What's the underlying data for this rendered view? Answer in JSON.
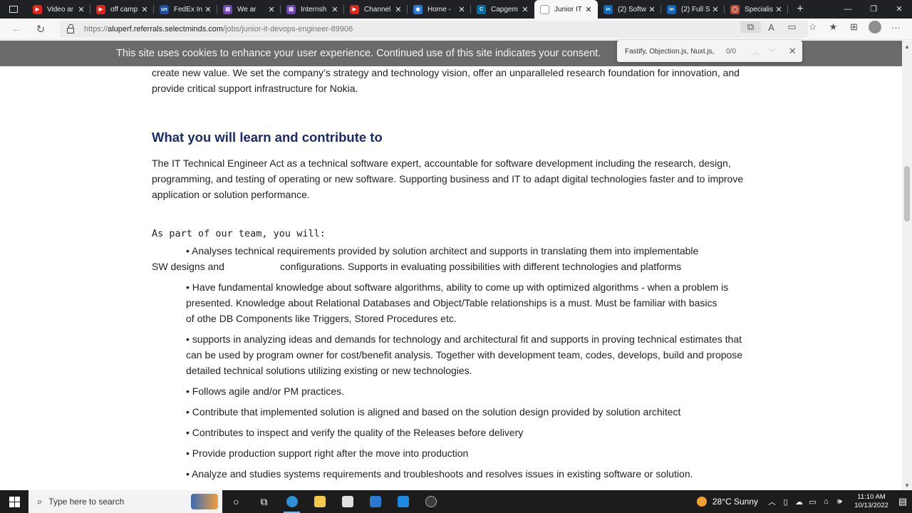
{
  "browser": {
    "tabs": [
      {
        "label": "Video ar",
        "favicon": "youtube-icon",
        "color": "#e62117",
        "glyph": "▶"
      },
      {
        "label": "off camp",
        "favicon": "youtube-icon",
        "color": "#e62117",
        "glyph": "▶"
      },
      {
        "label": "FedEx In",
        "favicon": "unstop-icon",
        "color": "#1c4fa0",
        "glyph": "un"
      },
      {
        "label": "We ar",
        "favicon": "forms-icon",
        "color": "#7248b9",
        "glyph": "▤"
      },
      {
        "label": "Internsh",
        "favicon": "forms-icon",
        "color": "#7248b9",
        "glyph": "▤"
      },
      {
        "label": "Channel",
        "favicon": "youtube-icon",
        "color": "#e62117",
        "glyph": "▶"
      },
      {
        "label": "Home -",
        "favicon": "edge-globe-icon",
        "color": "#2b79d7",
        "glyph": "◉"
      },
      {
        "label": "Capgem",
        "favicon": "capgemini-icon",
        "color": "#0070ad",
        "glyph": "C"
      },
      {
        "label": "Junior IT",
        "favicon": "blank-page-icon",
        "color": "#ffffff",
        "glyph": ""
      },
      {
        "label": "(2) Softw",
        "favicon": "linkedin-icon",
        "color": "#0a66c2",
        "glyph": "in"
      },
      {
        "label": "(2) Full S",
        "favicon": "linkedin-icon",
        "color": "#0a66c2",
        "glyph": "in"
      },
      {
        "label": "Specialis",
        "favicon": "oracle-icon",
        "color": "#c74634",
        "glyph": "◯"
      }
    ],
    "active_tab_index": 8,
    "url_prefix": "https://",
    "url_domain": "aluperf.referrals.selectminds.com",
    "url_path": "/jobs/junior-it-devops-engineer-89906"
  },
  "cookie_banner": {
    "text": "This site uses cookies to enhance your user experience. Continued use of this site indicates your consent."
  },
  "find_bar": {
    "query": "Fastify, Objection.js, Nuxt.js,",
    "count": "0/0"
  },
  "page": {
    "intro_line1": "create new value. We set the company’s strategy and technology vision, offer an unparalleled research foundation for innovation, and",
    "intro_line2": "provide critical support infrastructure for Nokia.",
    "heading": "What you will learn and contribute to",
    "desc_line1": "The IT Technical Engineer Act as a technical software expert, accountable for software development including the research, design,",
    "desc_line2": "programming, and testing of operating or new software. Supporting business and IT to adapt digital technologies faster and to improve",
    "desc_line3": "application or solution performance.",
    "team_label": "As part of our team, you will:",
    "b1_line1": "• Analyses technical requirements provided by solution architect and supports in translating them into implementable",
    "b1_line2a": "SW designs and",
    "b1_line2b": "configurations. Supports in evaluating possibilities with different technologies and platforms",
    "b2_line1": "• Have fundamental knowledge about software algorithms, ability to come up with optimized algorithms - when a problem is",
    "b2_line2": "presented.  Knowledge about Relational Databases and Object/Table relationships is a must.  Must be familiar with basics",
    "b2_line3": "of othe DB Components like Triggers, Stored Procedures etc.",
    "b3_line1": "• supports in analyzing ideas and demands for technology and architectural fit and supports in proving technical estimates that",
    "b3_line2": "can be used by program owner for cost/benefit analysis. Together with development team, codes, develops, build and propose",
    "b3_line3": "detailed technical solutions utilizing existing or new technologies.",
    "b4": "• Follows agile and/or PM practices.",
    "b5": "• Contribute that implemented solution is aligned and based on the solution design provided by solution architect",
    "b6": "• Contributes to inspect and verify the quality of the Releases before delivery",
    "b7": "• Provide production support right after the move into production",
    "b8": "• Analyze and studies systems requirements and troubleshoots and resolves issues in existing software or solution."
  },
  "taskbar": {
    "search_placeholder": "Type here to search",
    "weather": "28°C  Sunny",
    "time": "11:10 AM",
    "date": "10/13/2022"
  }
}
